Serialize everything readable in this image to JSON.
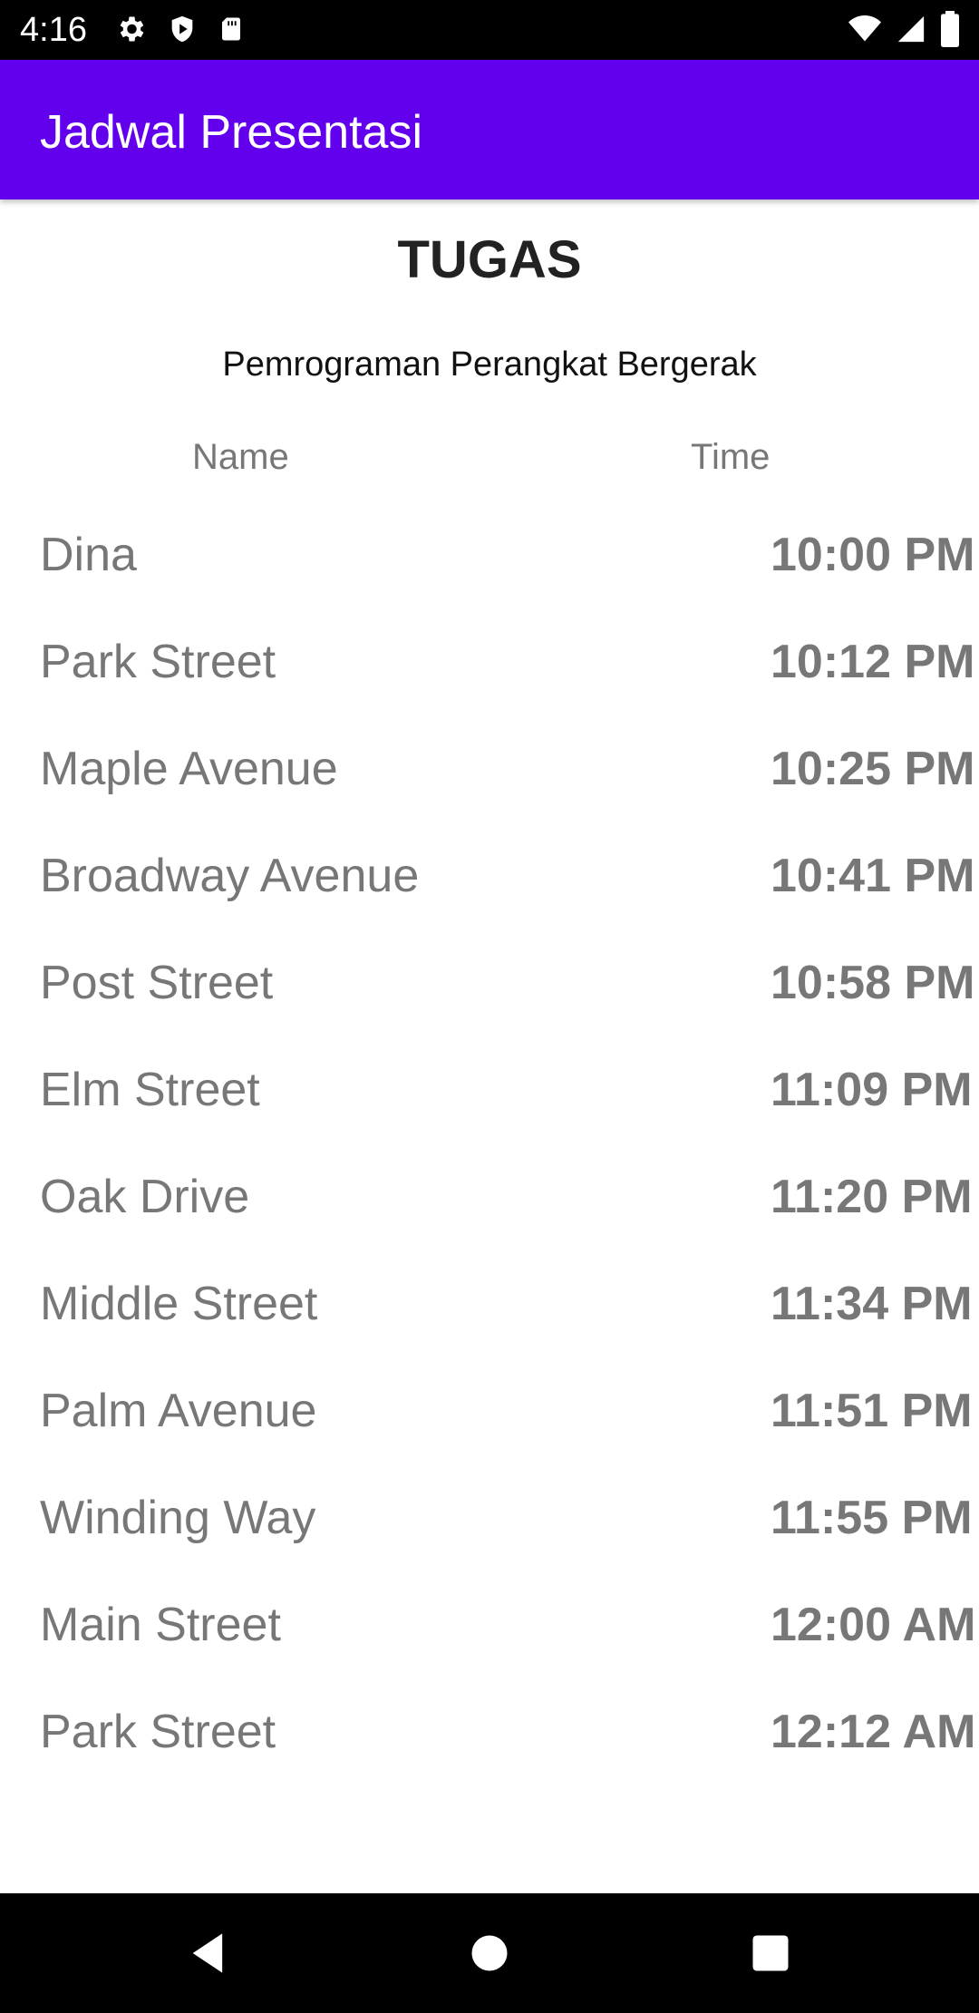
{
  "status_bar": {
    "time": "4:16",
    "left_icons": [
      "gear-icon",
      "shield-icon",
      "sd-card-icon"
    ],
    "right_icons": [
      "wifi-icon",
      "signal-icon",
      "battery-icon"
    ]
  },
  "app_bar": {
    "title": "Jadwal Presentasi",
    "color": "#6200ee"
  },
  "content": {
    "heading": "TUGAS",
    "subheading": "Pemrograman Perangkat Bergerak",
    "columns": {
      "name": "Name",
      "time": "Time"
    },
    "rows": [
      {
        "name": "Dina",
        "time": "10:00 PM"
      },
      {
        "name": "Park Street",
        "time": "10:12 PM"
      },
      {
        "name": "Maple Avenue",
        "time": "10:25 PM"
      },
      {
        "name": "Broadway Avenue",
        "time": "10:41 PM"
      },
      {
        "name": "Post Street",
        "time": "10:58 PM"
      },
      {
        "name": "Elm Street",
        "time": "11:09 PM"
      },
      {
        "name": "Oak Drive",
        "time": "11:20 PM"
      },
      {
        "name": "Middle Street",
        "time": "11:34 PM"
      },
      {
        "name": "Palm Avenue",
        "time": "11:51 PM"
      },
      {
        "name": "Winding Way",
        "time": "11:55 PM"
      },
      {
        "name": "Main Street",
        "time": "12:00 AM"
      },
      {
        "name": "Park Street",
        "time": "12:12 AM"
      }
    ]
  },
  "nav_bar": {
    "buttons": [
      "back-icon",
      "home-icon",
      "recents-icon"
    ]
  }
}
